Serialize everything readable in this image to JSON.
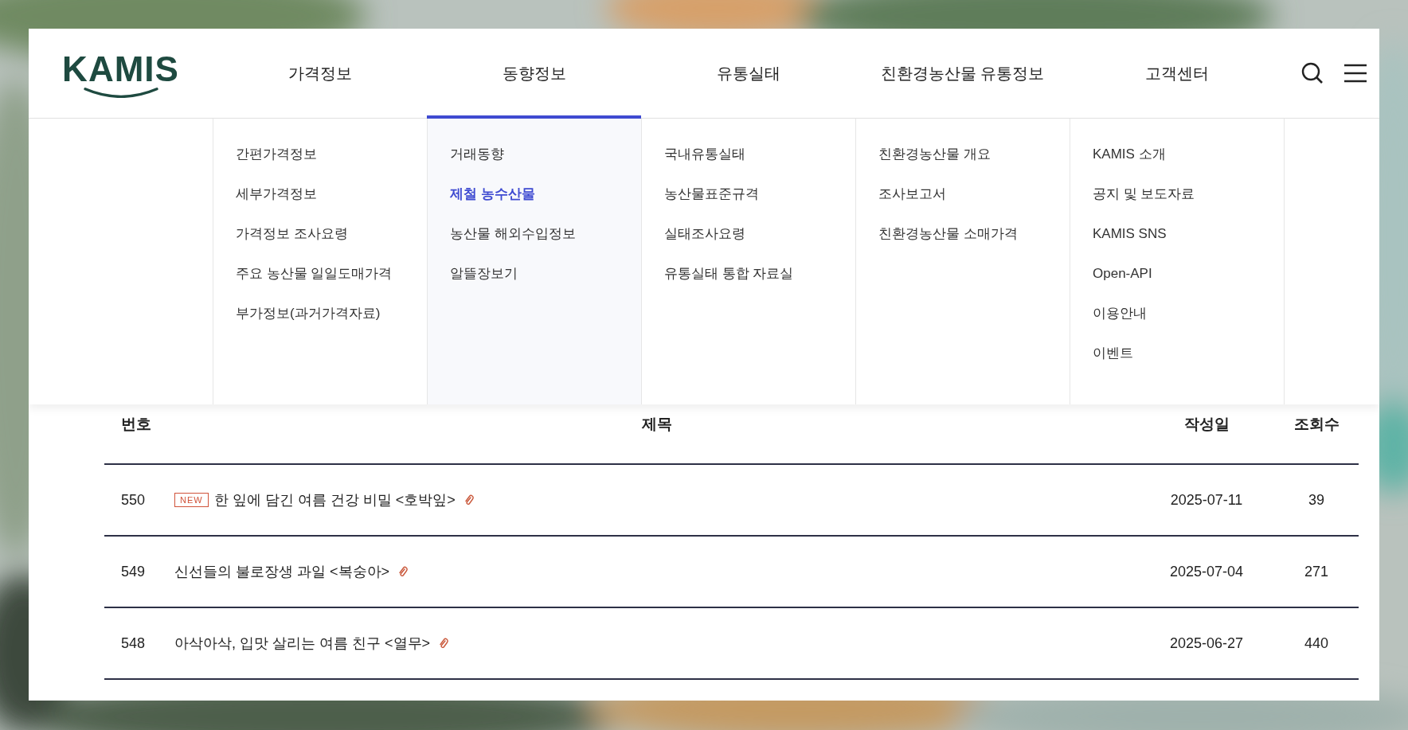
{
  "logo": {
    "text": "KAMIS"
  },
  "nav": [
    {
      "label": "가격정보",
      "selected": false
    },
    {
      "label": "동향정보",
      "selected": true
    },
    {
      "label": "유통실태",
      "selected": false
    },
    {
      "label": "친환경농산물 유통정보",
      "selected": false
    },
    {
      "label": "고객센터",
      "selected": false
    }
  ],
  "dropdown": [
    {
      "items": [
        {
          "label": "간편가격정보",
          "selected": false
        },
        {
          "label": "세부가격정보",
          "selected": false
        },
        {
          "label": "가격정보 조사요령",
          "selected": false
        },
        {
          "label": "주요 농산물 일일도매가격",
          "selected": false
        },
        {
          "label": "부가정보(과거가격자료)",
          "selected": false
        }
      ]
    },
    {
      "items": [
        {
          "label": "거래동향",
          "selected": false
        },
        {
          "label": "제철 농수산물",
          "selected": true
        },
        {
          "label": "농산물 해외수입정보",
          "selected": false
        },
        {
          "label": "알뜰장보기",
          "selected": false
        }
      ]
    },
    {
      "items": [
        {
          "label": "국내유통실태",
          "selected": false
        },
        {
          "label": "농산물표준규격",
          "selected": false
        },
        {
          "label": "실태조사요령",
          "selected": false
        },
        {
          "label": "유통실태 통합 자료실",
          "selected": false
        }
      ]
    },
    {
      "items": [
        {
          "label": "친환경농산물 개요",
          "selected": false
        },
        {
          "label": "조사보고서",
          "selected": false
        },
        {
          "label": "친환경농산물 소매가격",
          "selected": false
        }
      ]
    },
    {
      "items": [
        {
          "label": "KAMIS 소개",
          "selected": false
        },
        {
          "label": "공지 및 보도자료",
          "selected": false
        },
        {
          "label": "KAMIS SNS",
          "selected": false
        },
        {
          "label": "Open-API",
          "selected": false
        },
        {
          "label": "이용안내",
          "selected": false
        },
        {
          "label": "이벤트",
          "selected": false
        }
      ]
    }
  ],
  "table": {
    "columns": [
      "번호",
      "제목",
      "작성일",
      "조회수"
    ],
    "rows": [
      {
        "number": "550",
        "badge": "NEW",
        "title": "한 잎에 담긴 여름 건강 비밀 <호박잎>",
        "attachment": true,
        "date": "2025-07-11",
        "views": "39"
      },
      {
        "number": "549",
        "title": "신선들의 불로장생 과일 <복숭아>",
        "attachment": true,
        "date": "2025-07-04",
        "views": "271"
      },
      {
        "number": "548",
        "title": "아삭아삭, 입맛 살리는 여름 친구 <열무>",
        "attachment": true,
        "date": "2025-06-27",
        "views": "440"
      }
    ]
  }
}
